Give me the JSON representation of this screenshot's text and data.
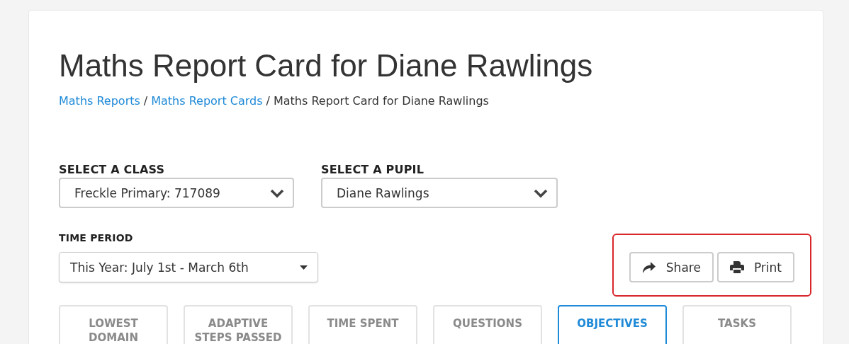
{
  "title": "Maths Report Card for Diane Rawlings",
  "breadcrumb_separator": "/",
  "breadcrumb": [
    {
      "label": "Maths Reports",
      "link": true
    },
    {
      "label": "Maths Report Cards",
      "link": true
    },
    {
      "label": "Maths Report Card for Diane Rawlings",
      "link": false
    }
  ],
  "class_select": {
    "label": "SELECT A CLASS",
    "value": "Freckle Primary: 717089"
  },
  "pupil_select": {
    "label": "SELECT A PUPIL",
    "value": "Diane Rawlings"
  },
  "time_period": {
    "label": "TIME PERIOD",
    "value": "This Year: July 1st - March 6th"
  },
  "actions": [
    {
      "kind": "share",
      "label": "Share"
    },
    {
      "kind": "print",
      "label": "Print"
    }
  ],
  "tabs": [
    {
      "label": "LOWEST DOMAIN",
      "selected": false
    },
    {
      "label": "ADAPTIVE STEPS PASSED",
      "selected": false
    },
    {
      "label": "TIME SPENT",
      "selected": false
    },
    {
      "label": "QUESTIONS",
      "selected": false
    },
    {
      "label": "OBJECTIVES",
      "selected": true
    },
    {
      "label": "TASKS",
      "selected": false
    }
  ]
}
